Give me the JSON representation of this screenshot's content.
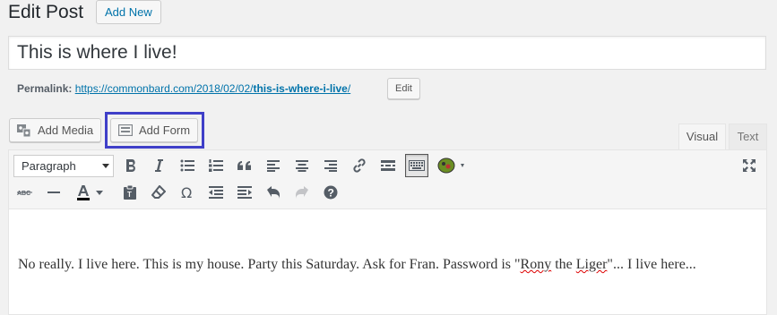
{
  "header": {
    "title": "Edit Post",
    "add_new_label": "Add New"
  },
  "post": {
    "title": "This is where I live!",
    "permalink_label": "Permalink:",
    "permalink_base": "https://commonbard.com/2018/02/02/",
    "permalink_slug": "this-is-where-i-live",
    "permalink_trailing": "/",
    "edit_label": "Edit"
  },
  "media_buttons": {
    "add_media_label": "Add Media",
    "add_form_label": "Add Form"
  },
  "tabs": {
    "visual_label": "Visual",
    "text_label": "Text"
  },
  "toolbar": {
    "format_value": "Paragraph"
  },
  "content": {
    "before": "No really.  I live here.  This is my house.  Party this Saturday.  Ask for Fran.  Password is \"",
    "word1": "Rony",
    "mid": " the ",
    "word2": "Liger",
    "after": "\"... I live here..."
  },
  "colors": {
    "accent": "#0073aa",
    "highlight_box": "#3f3fc8"
  }
}
